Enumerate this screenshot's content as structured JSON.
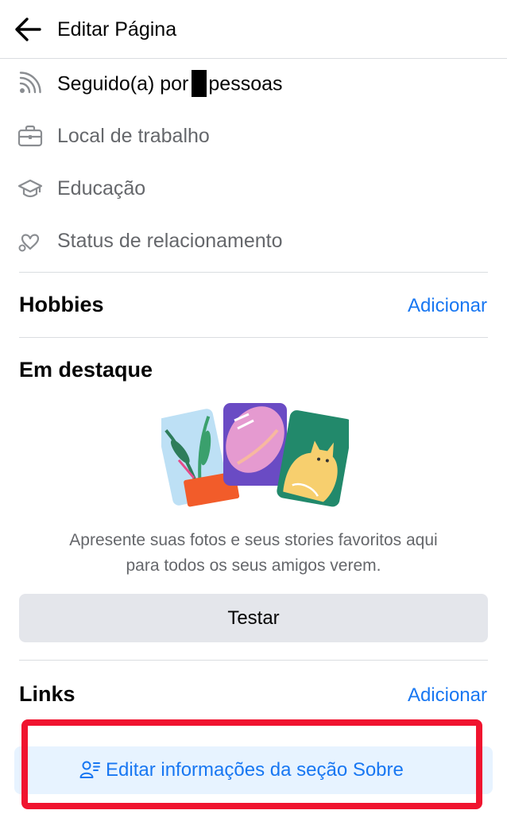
{
  "header": {
    "title": "Editar Página"
  },
  "details": [
    {
      "icon": "rss-icon",
      "prefix": "Seguido(a) por",
      "suffix": "pessoas"
    },
    {
      "icon": "briefcase-icon",
      "label": "Local de trabalho"
    },
    {
      "icon": "graduation-cap-icon",
      "label": "Educação"
    },
    {
      "icon": "heart-icon",
      "label": "Status de relacionamento"
    }
  ],
  "hobbies": {
    "title": "Hobbies",
    "action": "Adicionar"
  },
  "featured": {
    "title": "Em destaque",
    "description_line1": "Apresente suas fotos e seus stories favoritos aqui",
    "description_line2": "para todos os seus amigos verem.",
    "button": "Testar"
  },
  "links": {
    "title": "Links",
    "action": "Adicionar"
  },
  "edit_about": {
    "label": "Editar informações da seção Sobre",
    "icon": "person-list-icon"
  },
  "colors": {
    "accent": "#1877f2",
    "secondary_text": "#65676b",
    "highlight": "#f0142f",
    "button_gray": "#e4e6eb",
    "light_blue": "#e7f3ff"
  }
}
